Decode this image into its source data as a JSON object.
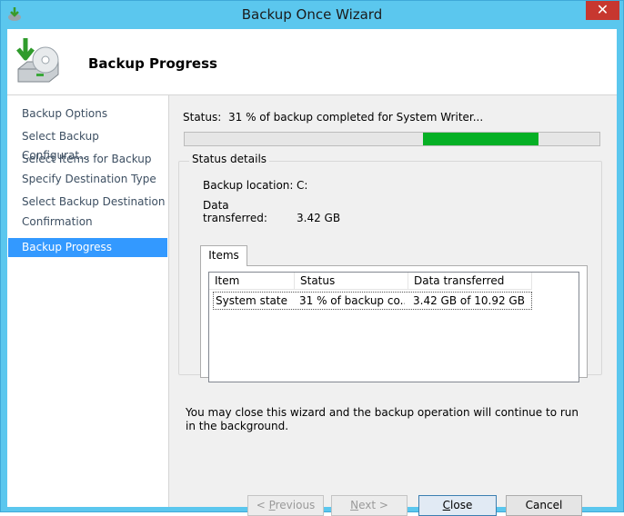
{
  "window": {
    "title": "Backup Once Wizard",
    "close_glyph": "✕"
  },
  "header": {
    "title": "Backup Progress"
  },
  "nav": {
    "items": [
      {
        "label": "Backup Options"
      },
      {
        "label": "Select Backup Configurat..."
      },
      {
        "label": "Select Items for Backup"
      },
      {
        "label": "Specify Destination Type"
      },
      {
        "label": "Select Backup Destination"
      },
      {
        "label": "Confirmation"
      },
      {
        "label": "Backup Progress"
      }
    ],
    "active_index": 6
  },
  "status": {
    "label": "Status:",
    "text": "31 % of backup completed for System Writer..."
  },
  "progress": {
    "indicator": "marquee",
    "accent": "#06b025"
  },
  "details": {
    "legend": "Status details",
    "location_label": "Backup location:",
    "location_value": "C:",
    "transferred_label": "Data transferred:",
    "transferred_value": "3.42 GB"
  },
  "items_tab": {
    "label": "Items"
  },
  "table": {
    "headers": [
      "Item",
      "Status",
      "Data transferred"
    ],
    "rows": [
      {
        "item": "System state",
        "status": "31 % of backup co...",
        "transferred": "3.42 GB of 10.92 GB"
      }
    ]
  },
  "note": "You may close this wizard and the backup operation will continue to run in the background.",
  "buttons": {
    "previous": {
      "prefix": "< ",
      "key": "P",
      "rest": "revious"
    },
    "next": {
      "key": "N",
      "rest": "ext >"
    },
    "close": {
      "key": "C",
      "rest": "lose"
    },
    "cancel": {
      "label": "Cancel"
    }
  },
  "colors": {
    "titlebar": "#5bc7ee",
    "nav_active": "#3399ff",
    "close_button": "#c7372f"
  }
}
